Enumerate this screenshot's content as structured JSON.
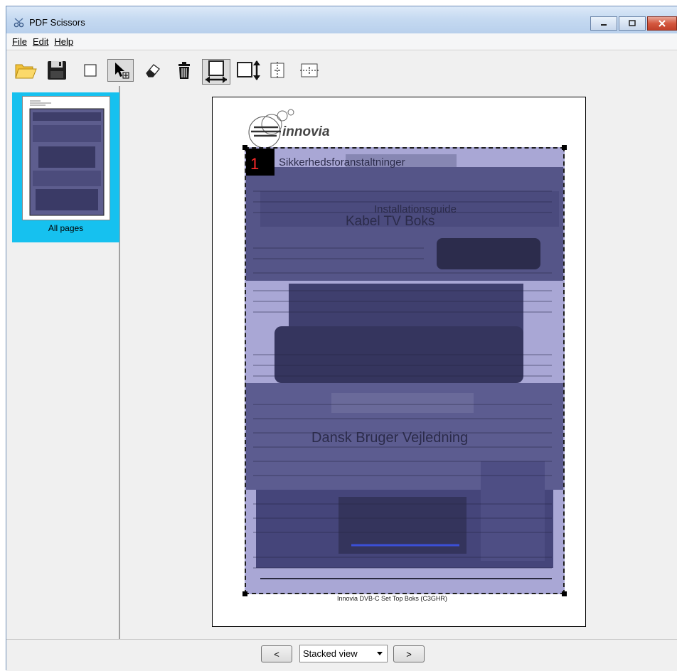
{
  "window": {
    "title": "PDF Scissors"
  },
  "menu": {
    "file": "File",
    "edit": "Edit",
    "help": "Help"
  },
  "toolbar": {
    "buttons": [
      "open-icon",
      "save-icon",
      "new-selection-icon",
      "select-tool-icon",
      "eraser-icon",
      "delete-icon",
      "fit-width-icon",
      "fit-height-icon",
      "split-vertical-icon",
      "split-horizontal-icon"
    ],
    "pressed": [
      "select-tool",
      "fit-width"
    ]
  },
  "sidebar": {
    "thumbnail_label": "All pages",
    "selected_color": "#16c1ef"
  },
  "page": {
    "logo_text": "innovia",
    "heading_1": "Sikkerhedsforanstaltninger",
    "heading_2": "Installationsguide",
    "heading_3": "Kabel TV Boks",
    "heading_4": "Dansk Bruger Vejledning",
    "footer_text": "Innovia DVB-C Set Top Boks (C3GHR)",
    "crop_number": "1",
    "overlay_color": "#a9a7d5"
  },
  "bottom": {
    "prev_label": "<",
    "next_label": ">",
    "view_mode": "Stacked view"
  }
}
